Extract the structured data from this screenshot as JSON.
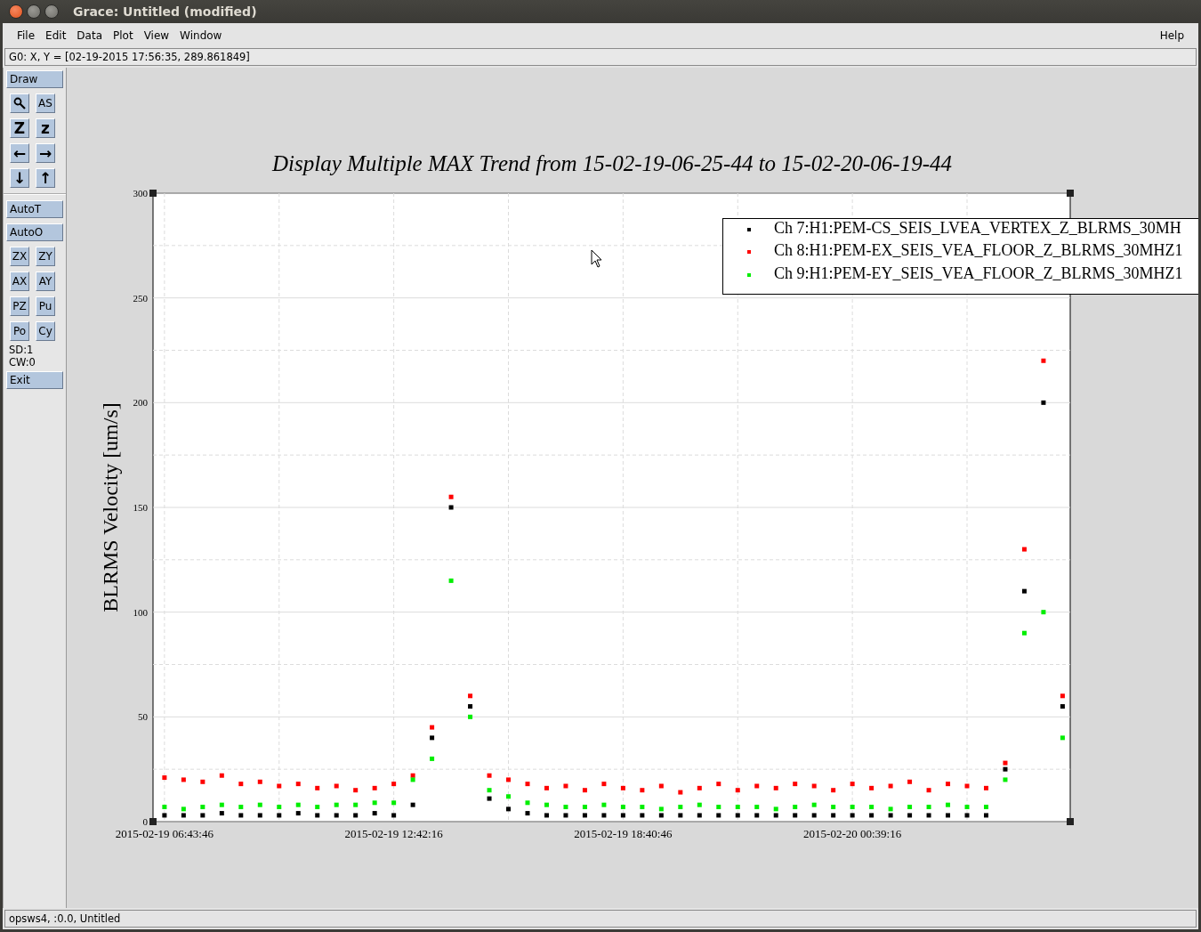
{
  "window": {
    "title": "Grace: Untitled (modified)"
  },
  "menu": [
    {
      "label": "File"
    },
    {
      "label": "Edit"
    },
    {
      "label": "Data"
    },
    {
      "label": "Plot"
    },
    {
      "label": "View"
    },
    {
      "label": "Window"
    }
  ],
  "help_menu": {
    "label": "Help"
  },
  "coordinate_readout": "G0: X, Y = [02-19-2015 17:56:35, 289.861849]",
  "toolbar": [
    {
      "kind": "wide",
      "label": "Draw"
    },
    {
      "kind": "pair",
      "buttons": [
        {
          "kind": "zoom"
        },
        {
          "kind": "text",
          "label": "AS"
        }
      ]
    },
    {
      "kind": "pair",
      "buttons": [
        {
          "kind": "text",
          "label": "Z"
        },
        {
          "kind": "text",
          "label": "z"
        }
      ]
    },
    {
      "kind": "pair",
      "buttons": [
        {
          "kind": "text",
          "label": "←"
        },
        {
          "kind": "text",
          "label": "→"
        }
      ]
    },
    {
      "kind": "pair",
      "buttons": [
        {
          "kind": "text",
          "label": "↓"
        },
        {
          "kind": "text",
          "label": "↑"
        }
      ]
    },
    {
      "kind": "separator"
    },
    {
      "kind": "wide",
      "label": "AutoT"
    },
    {
      "kind": "wide",
      "label": "AutoO"
    },
    {
      "kind": "pair",
      "buttons": [
        {
          "kind": "text",
          "label": "ZX"
        },
        {
          "kind": "text",
          "label": "ZY"
        }
      ]
    },
    {
      "kind": "pair",
      "buttons": [
        {
          "kind": "text",
          "label": "AX"
        },
        {
          "kind": "text",
          "label": "AY"
        }
      ]
    },
    {
      "kind": "pair",
      "buttons": [
        {
          "kind": "text",
          "label": "PZ"
        },
        {
          "kind": "text",
          "label": "Pu"
        }
      ]
    },
    {
      "kind": "pair",
      "buttons": [
        {
          "kind": "text",
          "label": "Po"
        },
        {
          "kind": "text",
          "label": "Cy"
        }
      ]
    },
    {
      "kind": "label",
      "label": "SD:1"
    },
    {
      "kind": "label",
      "label": "CW:0"
    },
    {
      "kind": "wide",
      "label": "Exit"
    }
  ],
  "graph": {
    "chart_data": {
      "type": "scatter",
      "title": "Display Multiple MAX Trend from 15-02-19-06-25-44 to 15-02-20-06-19-44",
      "ylabel": "BLRMS Velocity [um/s]",
      "ylim": [
        0,
        300
      ],
      "grid": true,
      "legend": "upper right",
      "categories": [
        "2015-02-19 06:43:46",
        null,
        null,
        null,
        null,
        null,
        null,
        null,
        null,
        null,
        null,
        null,
        "2015-02-19 12:42:16",
        null,
        null,
        null,
        null,
        null,
        null,
        null,
        null,
        null,
        null,
        null,
        "2015-02-19 18:40:46",
        null,
        null,
        null,
        null,
        null,
        null,
        null,
        null,
        null,
        null,
        null,
        "2015-02-20 00:39:16",
        null,
        null,
        null,
        null,
        null,
        null,
        null,
        null,
        null,
        null,
        null
      ],
      "yticks": [
        0,
        50,
        100,
        150,
        200,
        250,
        300
      ],
      "series": [
        {
          "name": "Ch 7:H1:PEM-CS_SEIS_LVEA_VERTEX_Z_BLRMS_30MH",
          "color": "#000000",
          "values": [
            3,
            3,
            3,
            4,
            3,
            3,
            3,
            4,
            3,
            3,
            3,
            4,
            3,
            8,
            40,
            150,
            55,
            11,
            6,
            4,
            3,
            3,
            3,
            3,
            3,
            3,
            3,
            3,
            3,
            3,
            3,
            3,
            3,
            3,
            3,
            3,
            3,
            3,
            3,
            3,
            3,
            3,
            3,
            3,
            25,
            110,
            200,
            55
          ]
        },
        {
          "name": "Ch 8:H1:PEM-EX_SEIS_VEA_FLOOR_Z_BLRMS_30MHZ1",
          "color": "#ff0000",
          "values": [
            21,
            20,
            19,
            22,
            18,
            19,
            17,
            18,
            16,
            17,
            15,
            16,
            18,
            22,
            45,
            155,
            60,
            22,
            20,
            18,
            16,
            17,
            15,
            18,
            16,
            15,
            17,
            14,
            16,
            18,
            15,
            17,
            16,
            18,
            17,
            15,
            18,
            16,
            17,
            19,
            15,
            18,
            17,
            16,
            28,
            130,
            220,
            60
          ]
        },
        {
          "name": "Ch 9:H1:PEM-EY_SEIS_VEA_FLOOR_Z_BLRMS_30MHZ1",
          "color": "#00ee00",
          "values": [
            7,
            6,
            7,
            8,
            7,
            8,
            7,
            8,
            7,
            8,
            8,
            9,
            9,
            20,
            30,
            115,
            50,
            15,
            12,
            9,
            8,
            7,
            7,
            8,
            7,
            7,
            6,
            7,
            8,
            7,
            7,
            7,
            6,
            7,
            8,
            7,
            7,
            7,
            6,
            7,
            7,
            8,
            7,
            7,
            20,
            90,
            100,
            40
          ]
        }
      ]
    }
  },
  "status_bar": "opsws4, :0.0, Untitled"
}
